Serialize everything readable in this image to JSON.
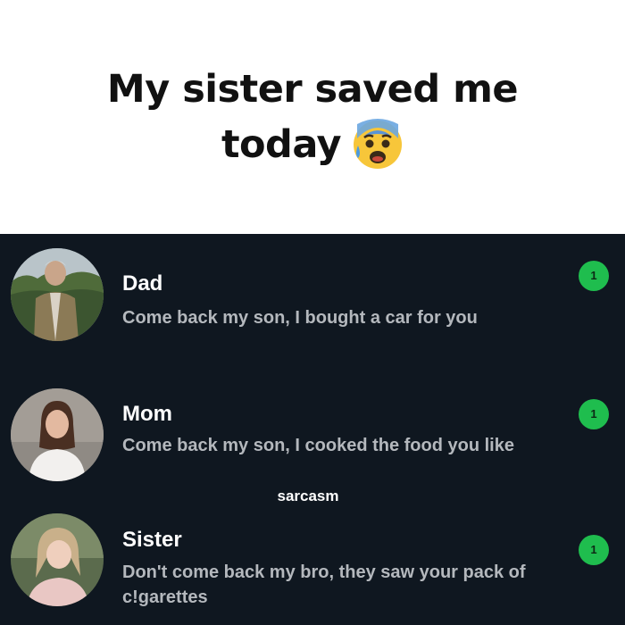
{
  "caption": {
    "line1": "My sister saved me",
    "line2": "today",
    "emoji": "anxious-face-with-sweat-icon"
  },
  "chats": [
    {
      "name": "Dad",
      "message": "Come back my son, I bought a car for you",
      "unread": "1",
      "avatar": "dad-avatar-photo"
    },
    {
      "name": "Mom",
      "message": "Come back my son, I cooked the food you like",
      "unread": "1",
      "avatar": "mom-avatar-photo"
    },
    {
      "name": "Sister",
      "message": "Don't come back my bro, they saw your pack of c!garettes",
      "unread": "1",
      "avatar": "sister-avatar-photo"
    }
  ],
  "annotation": "sarcasm",
  "colors": {
    "background": "#0f1720",
    "badge": "#1fbd4e",
    "message": "#b4b8bd",
    "name": "#ffffff"
  }
}
